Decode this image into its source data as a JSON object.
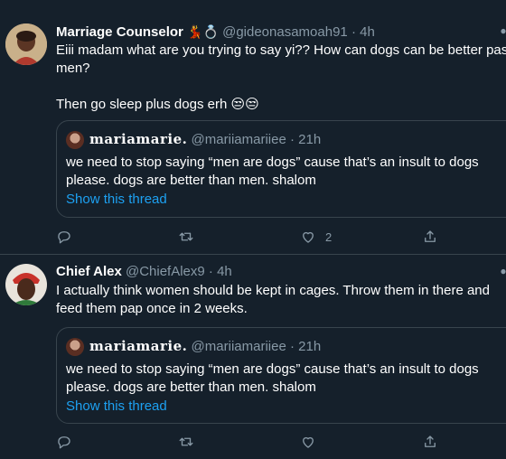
{
  "tweets": [
    {
      "name": "Marriage Counselor",
      "name_emoji": "💃💍",
      "handle": "@gideonasamoah91",
      "separator": "·",
      "time": "4h",
      "body": "Eiii madam what are you trying to say yi?? How can dogs can be better pass men?\n\nThen go sleep plus dogs erh 😒😒",
      "quote": {
        "name": "𝐦𝐚𝐫𝐢𝐚𝐦𝐚𝐫𝐢𝐞.",
        "handle": "@mariiamariiee",
        "separator": "·",
        "time": "21h",
        "body": "we need to stop saying “men are dogs” cause that’s an insult to dogs please. dogs are better than men. shalom",
        "link": "Show this thread"
      },
      "actions": {
        "reply": "",
        "retweet": "",
        "like": "2",
        "share": ""
      }
    },
    {
      "name": "Chief Alex",
      "handle": "@ChiefAlex9",
      "separator": "·",
      "time": "4h",
      "body": "I actually think women should be kept in cages. Throw them in there and feed them pap once in 2 weeks.",
      "quote": {
        "name": "𝐦𝐚𝐫𝐢𝐚𝐦𝐚𝐫𝐢𝐞.",
        "handle": "@mariiamariiee",
        "separator": "·",
        "time": "21h",
        "body": "we need to stop saying “men are dogs” cause that’s an insult to dogs please. dogs are better than men. shalom",
        "link": "Show this thread"
      },
      "actions": {
        "reply": "",
        "retweet": "",
        "like": "",
        "share": ""
      }
    }
  ],
  "colors": {
    "background": "#15202b",
    "border": "#38444d",
    "secondary_text": "#8899a6",
    "link": "#1da1f2"
  },
  "icons": [
    "reply-icon",
    "retweet-icon",
    "like-icon",
    "share-icon",
    "more-icon"
  ]
}
